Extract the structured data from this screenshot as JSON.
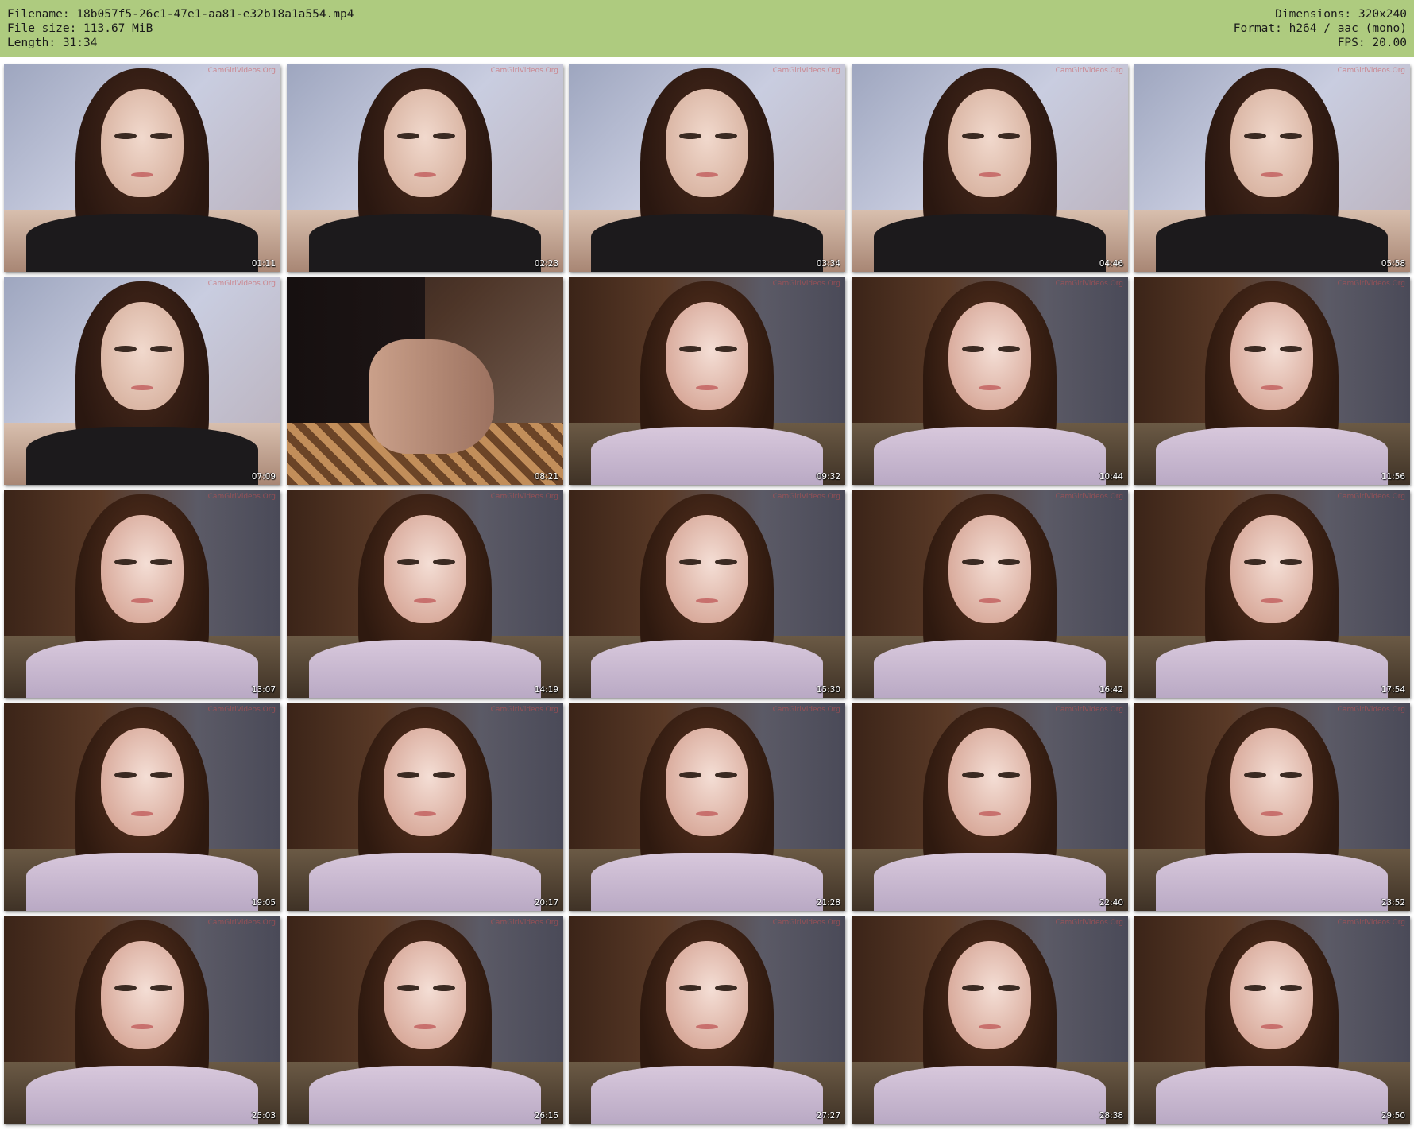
{
  "header": {
    "filename_line": "Filename: 18b057f5-26c1-47e1-aa81-e32b18a1a554.mp4",
    "filesize_line": "File size: 113.67 MiB",
    "length_line": "Length: 31:34",
    "dimensions_line": "Dimensions: 320x240",
    "format_line": "Format: h264 / aac (mono)",
    "fps_line": "FPS: 20.00",
    "background_color": "#aecb7f"
  },
  "thumbnails": [
    {
      "timestamp": "01:11",
      "watermark": "CamGirlVideos.Org",
      "scene": "light"
    },
    {
      "timestamp": "02:23",
      "watermark": "CamGirlVideos.Org",
      "scene": "light"
    },
    {
      "timestamp": "03:34",
      "watermark": "CamGirlVideos.Org",
      "scene": "light"
    },
    {
      "timestamp": "04:46",
      "watermark": "CamGirlVideos.Org",
      "scene": "light"
    },
    {
      "timestamp": "05:58",
      "watermark": "CamGirlVideos.Org",
      "scene": "light"
    },
    {
      "timestamp": "07:09",
      "watermark": "CamGirlVideos.Org",
      "scene": "light"
    },
    {
      "timestamp": "08:21",
      "watermark": "",
      "scene": "alt"
    },
    {
      "timestamp": "09:32",
      "watermark": "CamGirlVideos.Org",
      "scene": "dark"
    },
    {
      "timestamp": "10:44",
      "watermark": "CamGirlVideos.Org",
      "scene": "dark"
    },
    {
      "timestamp": "11:56",
      "watermark": "CamGirlVideos.Org",
      "scene": "dark"
    },
    {
      "timestamp": "13:07",
      "watermark": "CamGirlVideos.Org",
      "scene": "dark"
    },
    {
      "timestamp": "14:19",
      "watermark": "CamGirlVideos.Org",
      "scene": "dark"
    },
    {
      "timestamp": "15:30",
      "watermark": "CamGirlVideos.Org",
      "scene": "dark"
    },
    {
      "timestamp": "16:42",
      "watermark": "CamGirlVideos.Org",
      "scene": "dark"
    },
    {
      "timestamp": "17:54",
      "watermark": "CamGirlVideos.Org",
      "scene": "dark"
    },
    {
      "timestamp": "19:05",
      "watermark": "CamGirlVideos.Org",
      "scene": "dark"
    },
    {
      "timestamp": "20:17",
      "watermark": "CamGirlVideos.Org",
      "scene": "dark"
    },
    {
      "timestamp": "21:28",
      "watermark": "CamGirlVideos.Org",
      "scene": "dark"
    },
    {
      "timestamp": "22:40",
      "watermark": "CamGirlVideos.Org",
      "scene": "dark"
    },
    {
      "timestamp": "23:52",
      "watermark": "CamGirlVideos.Org",
      "scene": "dark"
    },
    {
      "timestamp": "25:03",
      "watermark": "CamGirlVideos.Org",
      "scene": "dark"
    },
    {
      "timestamp": "26:15",
      "watermark": "CamGirlVideos.Org",
      "scene": "dark"
    },
    {
      "timestamp": "27:27",
      "watermark": "CamGirlVideos.Org",
      "scene": "dark"
    },
    {
      "timestamp": "28:38",
      "watermark": "CamGirlVideos.Org",
      "scene": "dark"
    },
    {
      "timestamp": "29:50",
      "watermark": "CamGirlVideos.Org",
      "scene": "dark"
    }
  ]
}
